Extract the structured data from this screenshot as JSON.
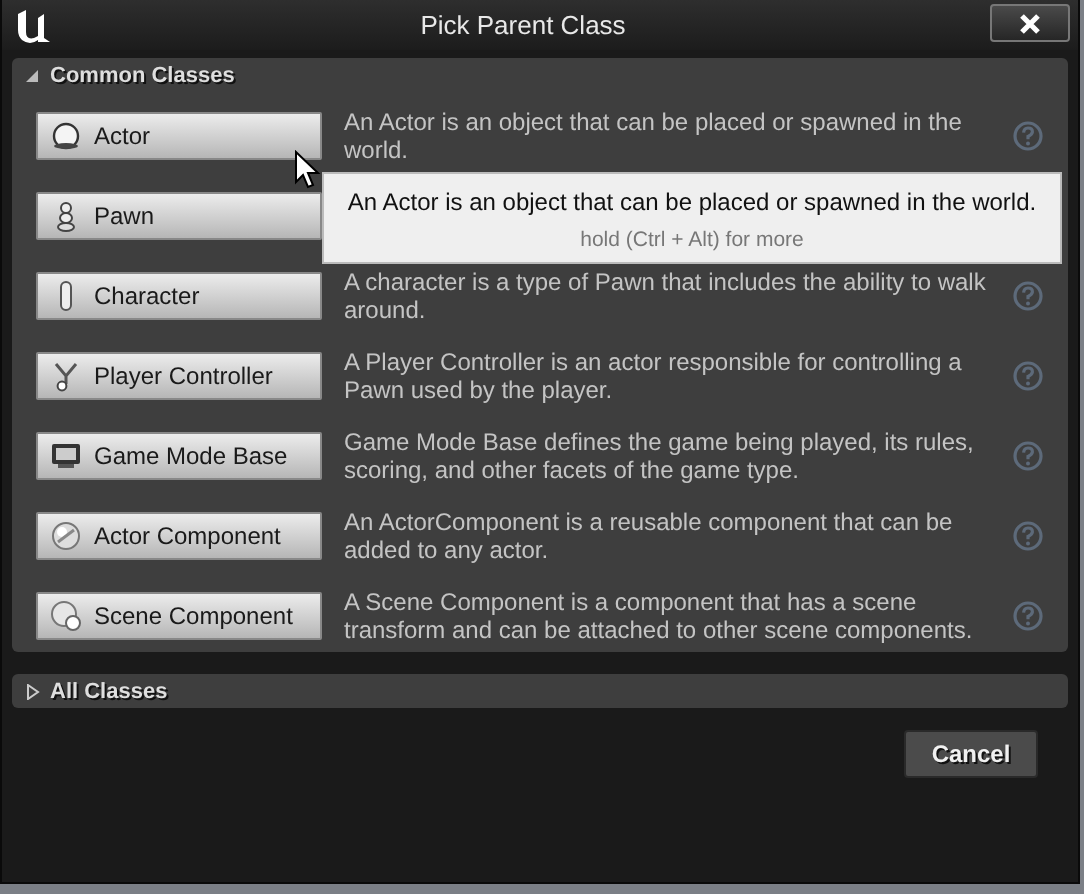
{
  "window": {
    "title": "Pick Parent Class"
  },
  "sections": [
    {
      "label": "Common Classes",
      "expanded": true,
      "classes": [
        {
          "kind": "actor",
          "label": "Actor",
          "description": "An Actor is an object that can be placed or spawned in the world.",
          "help": true
        },
        {
          "kind": "pawn",
          "label": "Pawn",
          "help": false
        },
        {
          "kind": "character",
          "label": "Character",
          "description": "A character is a type of Pawn that includes the ability to walk around.",
          "help": true
        },
        {
          "kind": "controller",
          "label": "Player Controller",
          "description": "A Player Controller is an actor responsible for controlling a Pawn used by the player.",
          "help": true
        },
        {
          "kind": "gamemode",
          "label": "Game Mode Base",
          "description": "Game Mode Base defines the game being played, its rules, scoring, and other facets of the game type.",
          "help": true
        },
        {
          "kind": "actorcomponent",
          "label": "Actor Component",
          "description": "An ActorComponent is a reusable component that can be added to any actor.",
          "help": true
        },
        {
          "kind": "scenecomponent",
          "label": "Scene Component",
          "description": "A Scene Component is a component that has a scene transform and can be attached to other scene components.",
          "help": true
        }
      ]
    },
    {
      "label": "All Classes",
      "expanded": false
    }
  ],
  "tooltip": {
    "text": "An Actor is an object that can be placed or spawned in the world.",
    "hint": "hold (Ctrl + Alt) for more"
  },
  "buttons": [
    "Cancel"
  ]
}
